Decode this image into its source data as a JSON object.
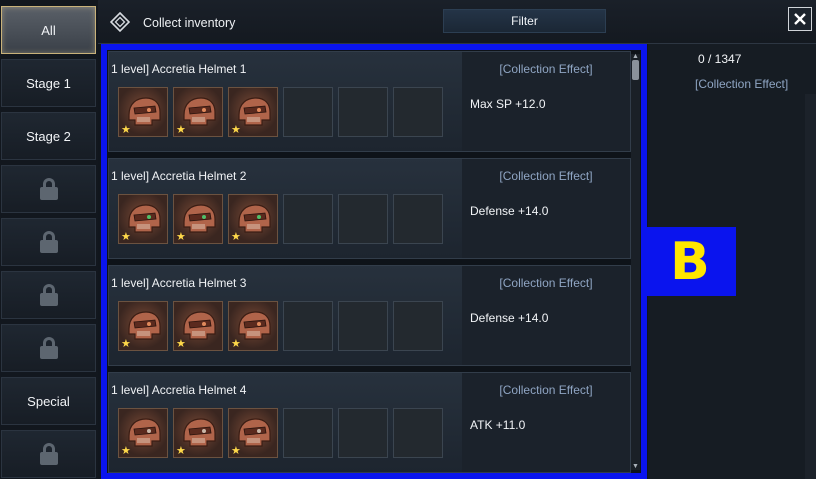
{
  "header": {
    "title": "Collect inventory",
    "filter_label": "Filter",
    "close_icon": "close-icon"
  },
  "sidebar": {
    "items": [
      {
        "label": "All",
        "active": true,
        "locked": false
      },
      {
        "label": "Stage 1",
        "active": false,
        "locked": false
      },
      {
        "label": "Stage 2",
        "active": false,
        "locked": false
      },
      {
        "label": "",
        "active": false,
        "locked": true
      },
      {
        "label": "",
        "active": false,
        "locked": true
      },
      {
        "label": "",
        "active": false,
        "locked": true
      },
      {
        "label": "",
        "active": false,
        "locked": true
      },
      {
        "label": "Special",
        "active": false,
        "locked": false
      },
      {
        "label": "",
        "active": false,
        "locked": true
      }
    ]
  },
  "collections": [
    {
      "name": "1 level] Accretia Helmet 1",
      "effect_title": "[Collection Effect]",
      "effect_stat": "Max SP +12.0",
      "filled_slots": 3,
      "total_slots": 6
    },
    {
      "name": "1 level] Accretia Helmet 2",
      "effect_title": "[Collection Effect]",
      "effect_stat": "Defense +14.0",
      "filled_slots": 3,
      "total_slots": 6
    },
    {
      "name": "1 level] Accretia Helmet 3",
      "effect_title": "[Collection Effect]",
      "effect_stat": "Defense +14.0",
      "filled_slots": 3,
      "total_slots": 6
    },
    {
      "name": "1 level] Accretia Helmet 4",
      "effect_title": "[Collection Effect]",
      "effect_stat": "ATK +11.0",
      "filled_slots": 3,
      "total_slots": 6
    }
  ],
  "right_panel": {
    "count": "0 / 1347",
    "effect_title": "[Collection Effect]"
  },
  "overlay_label": "B",
  "colors": {
    "highlight_blue": "#0a14ee",
    "overlay_text": "#ffe600",
    "effect_title": "#8fa5c3",
    "star": "#ffd94a"
  }
}
